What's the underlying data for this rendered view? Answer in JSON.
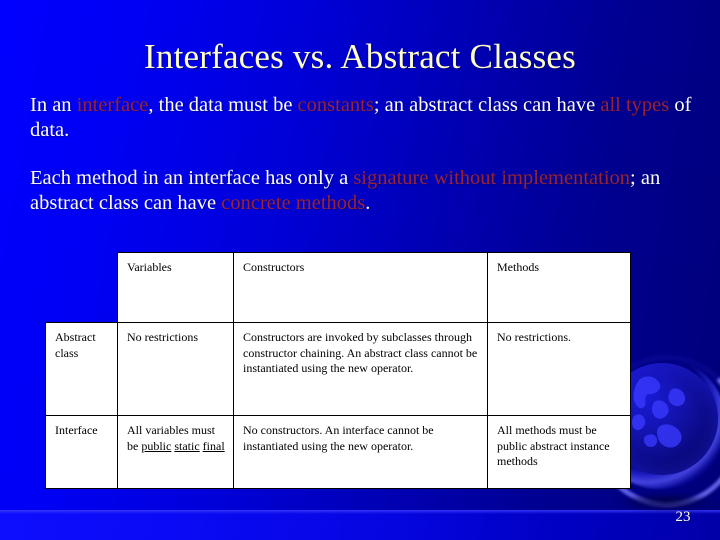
{
  "slide": {
    "title": "Interfaces vs. Abstract Classes",
    "page_number": "23",
    "background_color": "#0000cc",
    "title_color": "#ffffcc",
    "highlight_color": "#992233",
    "body_text_color": "#ffffff"
  },
  "paragraphs": {
    "p1": {
      "seg1": "In an ",
      "hl1": "interface",
      "seg2": ", the data must be ",
      "hl2": "constants",
      "seg3": "; an abstract class can have ",
      "hl3": "all types",
      "seg4": " of data."
    },
    "p2": {
      "seg1": "Each method in an interface has only a ",
      "hl1": "signature without implementation",
      "seg2": "; an abstract class can have ",
      "hl2": "concrete methods",
      "seg3": "."
    }
  },
  "table": {
    "corner": "",
    "headers": [
      "Variables",
      "Constructors",
      "Methods"
    ],
    "rows": [
      {
        "label": "Abstract class",
        "variables": "No restrictions",
        "constructors": "Constructors are invoked by subclasses through constructor chaining. An abstract class cannot be instantiated using the new operator.",
        "methods": "No restrictions."
      },
      {
        "label": "Interface",
        "variables_prefix": "All variables must be ",
        "variables_underlined_1": "public",
        "variables_mid": " ",
        "variables_underlined_2": "static",
        "variables_mid_2": " ",
        "variables_underlined_3": "final",
        "constructors": "No constructors. An interface cannot be instantiated using the new operator.",
        "methods": "All methods must be public abstract instance methods"
      }
    ]
  },
  "decor": {
    "globe_label": "globe-graphic"
  }
}
